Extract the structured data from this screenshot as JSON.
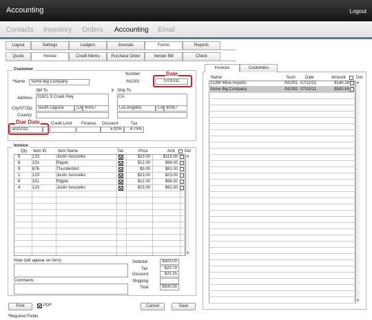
{
  "app": {
    "title": "Accounting",
    "logout": "Logout"
  },
  "nav": [
    "Contacts",
    "Inventory",
    "Orders",
    "Accounting",
    "Email"
  ],
  "tabs_row1": [
    "Logout",
    "Settings",
    "Ledgers",
    "Journals",
    "Forms",
    "Reports"
  ],
  "tabs_row2": [
    "Quote",
    "Invoice",
    "Credit Memo",
    "Purchase Order",
    "Vendor Bill",
    "Check"
  ],
  "customer": {
    "legend": "Customer",
    "name_label": "*Name",
    "name": "Some Big Company",
    "number_label": "Number",
    "number": "IN1002",
    "date_label": "Date",
    "date": "07/20/11",
    "bill_to_label": "Bill To",
    "ship_to_label": "Ship To",
    "address_label": "Address",
    "bill_address": "31921 S Coast Hwy",
    "ship_address": "CA",
    "city_label": "City/ST/Zip",
    "bill_city": "South Laguna",
    "bill_st": "CA",
    "bill_zip": "90057",
    "ship_city": "Los Angeles",
    "ship_st": "CA",
    "ship_zip": "90057",
    "country_label": "Country",
    "due_date_label": "Due Date",
    "due_date": "8/3/2011",
    "credit_limit_label": "Credit Limit",
    "finance_label": "Finance",
    "discount_label": "Discount",
    "discount": "5.00%",
    "tax_label": "Tax",
    "tax": "4.75%"
  },
  "invoice": {
    "legend": "Invoice",
    "headers": {
      "qty": "Qty",
      "item_id": "Item ID",
      "item_name": "Item Name",
      "tax": "Tax",
      "price": "Price",
      "amt": "Amt",
      "del": "Del"
    },
    "rows": [
      {
        "qty": "5",
        "item_id": "123",
        "item_name": "Justin Isosceles",
        "price": "$23.00",
        "amt": "$115.00"
      },
      {
        "qty": "8",
        "item_id": "151",
        "item_name": "Ripple",
        "price": "$12.00",
        "amt": "$96.00"
      },
      {
        "qty": "9",
        "item_id": "876",
        "item_name": "Thunderbird",
        "price": "$9.00",
        "amt": "$81.00"
      },
      {
        "qty": "1",
        "item_id": "123",
        "item_name": "Justin Isosceles",
        "price": "$23.00",
        "amt": "$23.00"
      },
      {
        "qty": "8",
        "item_id": "151",
        "item_name": "Ripple",
        "price": "$12.00",
        "amt": "$96.00"
      },
      {
        "qty": "4",
        "item_id": "123",
        "item_name": "Justin Isosceles",
        "price": "$23.00",
        "amt": "$92.00"
      }
    ],
    "note_label": "Note (will appear on form)",
    "comments_label": "Comments",
    "totals": {
      "subtotal_label": "Subtotal",
      "subtotal": "$503.00",
      "tax_label": "Tax",
      "tax": "$22.70",
      "discount_label": "Discount",
      "discount": "$25.15",
      "shipping_label": "Shipping",
      "shipping": "",
      "total_label": "Total",
      "total": "$500.55"
    }
  },
  "buttons": {
    "print": "Print",
    "pdf": "PDF",
    "cancel": "Cancel",
    "save": "Save"
  },
  "required_note": "*Required Fields",
  "side": {
    "tabs": [
      "Invoices",
      "Customers"
    ],
    "headers": {
      "name": "Name",
      "num": "Num",
      "date": "Date",
      "amount": "Amount",
      "del": "Del"
    },
    "rows": [
      {
        "name": "213W Wine Imports",
        "num": "IN1001",
        "date": "07/12/11",
        "amount": "$140.39"
      },
      {
        "name": "Some Big Company",
        "num": "IN1002",
        "date": "07/20/11",
        "amount": "$500.55"
      }
    ]
  },
  "colors": {
    "highlight": "#c42026",
    "nav_accent": "#5b7a86",
    "selected_row": "#c9c9c9"
  }
}
